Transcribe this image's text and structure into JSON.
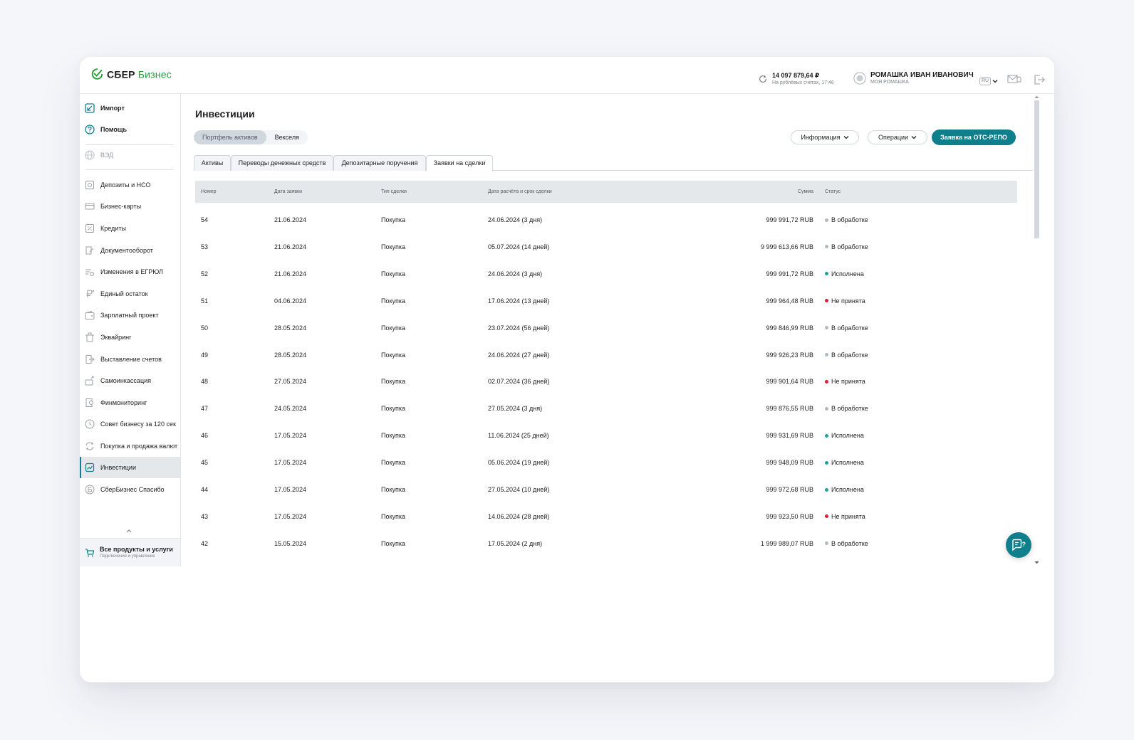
{
  "header": {
    "logo_main": "СБЕР",
    "logo_sub": "Бизнес",
    "balance_amount": "14 097 879,64 ₽",
    "balance_caption": "На рублёвых счетах, 17:46",
    "user_name": "РОМАШКА ИВАН ИВАНОВИЧ",
    "user_org": "МОЯ РОМАШКА",
    "lang": "RU"
  },
  "sidebar": {
    "items": [
      {
        "label": "Импорт",
        "icon": "import-icon"
      },
      {
        "label": "Помощь",
        "icon": "help-icon"
      },
      {
        "label": "ВЭД",
        "icon": "globe-icon"
      },
      {
        "label": "Депозиты и НСО",
        "icon": "deposit-icon"
      },
      {
        "label": "Бизнес-карты",
        "icon": "card-icon"
      },
      {
        "label": "Кредиты",
        "icon": "credit-icon"
      },
      {
        "label": "Документооборот",
        "icon": "document-flow-icon"
      },
      {
        "label": "Изменения в ЕГРЮЛ",
        "icon": "registry-icon"
      },
      {
        "label": "Единый остаток",
        "icon": "ruble-icon"
      },
      {
        "label": "Зарплатный проект",
        "icon": "wallet-icon"
      },
      {
        "label": "Эквайринг",
        "icon": "acquiring-icon"
      },
      {
        "label": "Выставление счетов",
        "icon": "invoice-icon"
      },
      {
        "label": "Самоинкассация",
        "icon": "cash-collection-icon"
      },
      {
        "label": "Финмониторинг",
        "icon": "monitoring-icon"
      },
      {
        "label": "Совет бизнесу за 120 сек",
        "icon": "clock-icon"
      },
      {
        "label": "Покупка и продажа валют",
        "icon": "currency-exchange-icon"
      },
      {
        "label": "Инвестиции",
        "icon": "investments-icon"
      },
      {
        "label": "СберБизнес Спасибо",
        "icon": "bonus-icon"
      }
    ],
    "all_products_title": "Все продукты и услуги",
    "all_products_sub": "Подключение и управление"
  },
  "main": {
    "title": "Инвестиции",
    "segments": [
      "Портфель активов",
      "Векселя"
    ],
    "info_button": "Информация",
    "operations_button": "Операции",
    "primary_button": "Заявка на ОТС-РЕПО",
    "tabs": [
      "Активы",
      "Переводы денежных средств",
      "Депозитарные поручения",
      "Заявки на сделки"
    ],
    "active_tab": "Заявки на сделки",
    "table": {
      "headers": [
        "Номер",
        "Дата заявки",
        "Тип сделки",
        "Дата расчёта и срок сделки",
        "Сумма",
        "Статус"
      ],
      "rows": [
        {
          "num": "54",
          "date": "21.06.2024",
          "type": "Покупка",
          "settle": "24.06.2024 (3 дня)",
          "sum": "999 991,72 RUB",
          "status": "В обработке",
          "status_color": "#b2b8bf"
        },
        {
          "num": "53",
          "date": "21.06.2024",
          "type": "Покупка",
          "settle": "05.07.2024 (14 дней)",
          "sum": "9 999 613,66 RUB",
          "status": "В обработке",
          "status_color": "#b2b8bf"
        },
        {
          "num": "52",
          "date": "21.06.2024",
          "type": "Покупка",
          "settle": "24.06.2024 (3 дня)",
          "sum": "999 991,72 RUB",
          "status": "Исполнена",
          "status_color": "#21a19a"
        },
        {
          "num": "51",
          "date": "04.06.2024",
          "type": "Покупка",
          "settle": "17.06.2024 (13 дней)",
          "sum": "999 964,48 RUB",
          "status": "Не принята",
          "status_color": "#db1f35"
        },
        {
          "num": "50",
          "date": "28.05.2024",
          "type": "Покупка",
          "settle": "23.07.2024 (56 дней)",
          "sum": "999 846,99 RUB",
          "status": "В обработке",
          "status_color": "#b2b8bf"
        },
        {
          "num": "49",
          "date": "28.05.2024",
          "type": "Покупка",
          "settle": "24.06.2024 (27 дней)",
          "sum": "999 926,23 RUB",
          "status": "В обработке",
          "status_color": "#b2b8bf"
        },
        {
          "num": "48",
          "date": "27.05.2024",
          "type": "Покупка",
          "settle": "02.07.2024 (36 дней)",
          "sum": "999 901,64 RUB",
          "status": "Не принята",
          "status_color": "#db1f35"
        },
        {
          "num": "47",
          "date": "24.05.2024",
          "type": "Покупка",
          "settle": "27.05.2024 (3 дня)",
          "sum": "999 876,55 RUB",
          "status": "В обработке",
          "status_color": "#b2b8bf"
        },
        {
          "num": "46",
          "date": "17.05.2024",
          "type": "Покупка",
          "settle": "11.06.2024 (25 дней)",
          "sum": "999 931,69 RUB",
          "status": "Исполнена",
          "status_color": "#21a19a"
        },
        {
          "num": "45",
          "date": "17.05.2024",
          "type": "Покупка",
          "settle": "05.06.2024 (19 дней)",
          "sum": "999 948,09 RUB",
          "status": "Исполнена",
          "status_color": "#21a19a"
        },
        {
          "num": "44",
          "date": "17.05.2024",
          "type": "Покупка",
          "settle": "27.05.2024 (10 дней)",
          "sum": "999 972,68 RUB",
          "status": "Исполнена",
          "status_color": "#21a19a"
        },
        {
          "num": "43",
          "date": "17.05.2024",
          "type": "Покупка",
          "settle": "14.06.2024 (28 дней)",
          "sum": "999 923,50 RUB",
          "status": "Не принята",
          "status_color": "#db1f35"
        },
        {
          "num": "42",
          "date": "15.05.2024",
          "type": "Покупка",
          "settle": "17.05.2024 (2 дня)",
          "sum": "1 999 989,07 RUB",
          "status": "В обработке",
          "status_color": "#b2b8bf"
        }
      ]
    }
  },
  "colors": {
    "accent": "#107f8c",
    "brand_green": "#21a038",
    "status_processing": "#b2b8bf",
    "status_done": "#21a19a",
    "status_rejected": "#db1f35"
  }
}
